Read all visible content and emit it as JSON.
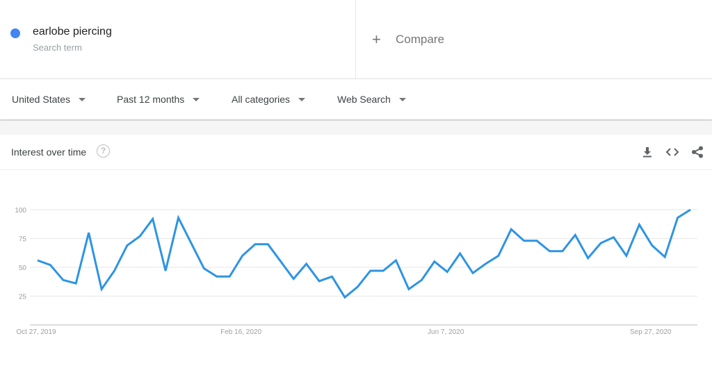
{
  "search_term": {
    "name": "earlobe piercing",
    "subtitle": "Search term",
    "color": "#4285f4"
  },
  "compare": {
    "icon": "plus-icon",
    "label": "Compare"
  },
  "filters": [
    {
      "label": "United States",
      "icon": "caret-down-icon"
    },
    {
      "label": "Past 12 months",
      "icon": "caret-down-icon"
    },
    {
      "label": "All categories",
      "icon": "caret-down-icon"
    },
    {
      "label": "Web Search",
      "icon": "caret-down-icon"
    }
  ],
  "widget": {
    "title": "Interest over time",
    "help_icon": "?",
    "actions": [
      {
        "name": "download-icon"
      },
      {
        "name": "embed-icon"
      },
      {
        "name": "share-icon"
      }
    ]
  },
  "chart_data": {
    "type": "line",
    "title": "Interest over time",
    "xlabel": "",
    "ylabel": "",
    "ylim": [
      0,
      100
    ],
    "yticks": [
      25,
      50,
      75,
      100
    ],
    "xtick_labels": [
      {
        "label": "Oct 27, 2019",
        "index": 0
      },
      {
        "label": "Feb 16, 2020",
        "index": 16
      },
      {
        "label": "Jun 7, 2020",
        "index": 32
      },
      {
        "label": "Sep 27, 2020",
        "index": 48
      }
    ],
    "grid": true,
    "legend": "none",
    "series": [
      {
        "name": "earlobe piercing",
        "color": "#2d94e3",
        "values": [
          56,
          52,
          39,
          36,
          80,
          31,
          47,
          69,
          77,
          92,
          47,
          93,
          71,
          49,
          42,
          42,
          60,
          70,
          70,
          55,
          40,
          53,
          38,
          42,
          24,
          33,
          47,
          47,
          56,
          31,
          39,
          55,
          46,
          62,
          45,
          53,
          60,
          83,
          73,
          73,
          64,
          64,
          78,
          58,
          71,
          76,
          60,
          87,
          69,
          59,
          93,
          100
        ]
      }
    ]
  }
}
